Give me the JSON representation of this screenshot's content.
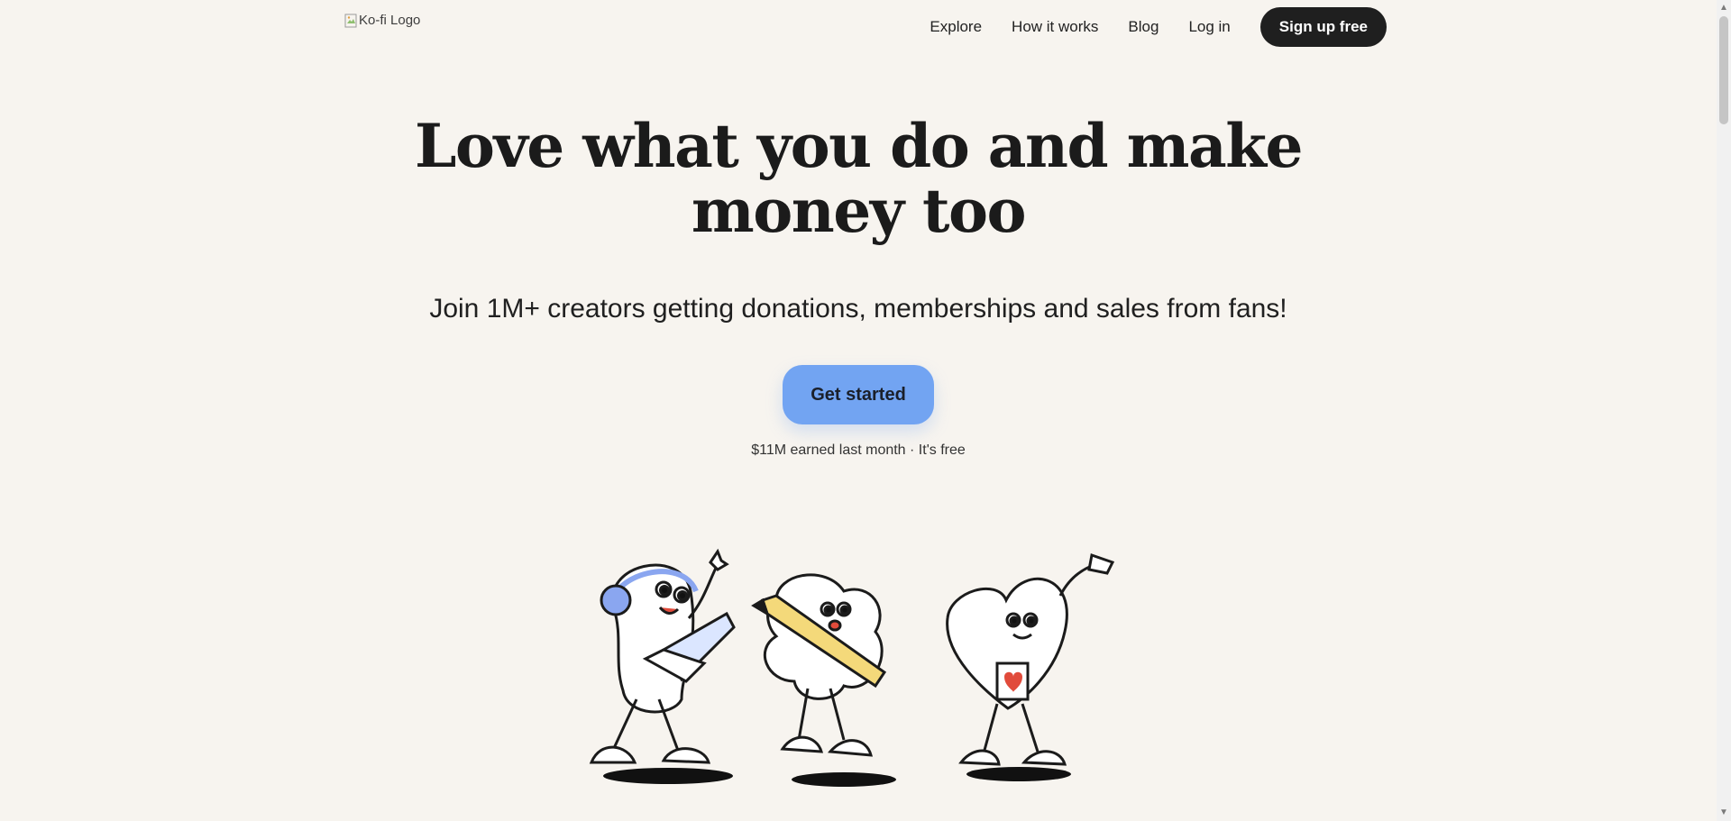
{
  "header": {
    "logo_alt": "Ko-fi Logo",
    "nav": [
      {
        "label": "Explore"
      },
      {
        "label": "How it works"
      },
      {
        "label": "Blog"
      },
      {
        "label": "Log in"
      }
    ],
    "signup_label": "Sign up free"
  },
  "hero": {
    "title_line1": "Love what you do and make",
    "title_line2": "money too",
    "subtitle": "Join 1M+ creators getting donations, memberships and sales from fans!",
    "cta_label": "Get started",
    "earned_text": "$11M earned last month · It's free"
  },
  "colors": {
    "background": "#f7f4ef",
    "cta": "#72a4f2",
    "signup": "#1f1f1f",
    "accent_red": "#e14b3b",
    "accent_yellow": "#f4d97a",
    "headphones": "#8aa6f0"
  },
  "icons": {
    "broken_image": "broken-image-icon",
    "scroll_up": "scroll-up-icon",
    "scroll_down": "scroll-down-icon"
  }
}
